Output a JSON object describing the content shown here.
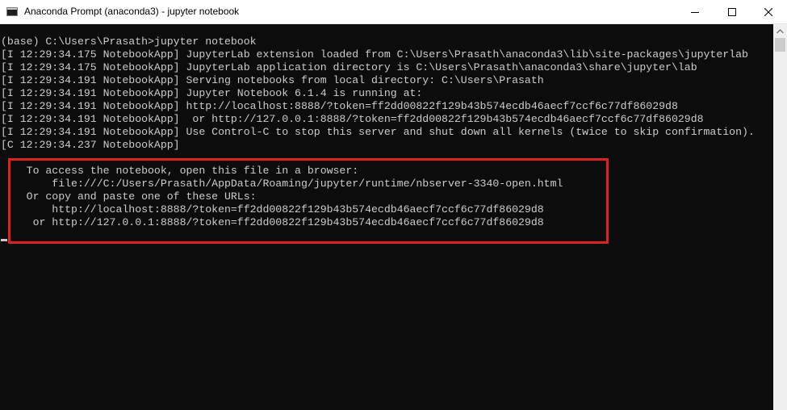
{
  "window": {
    "title": "Anaconda Prompt (anaconda3) - jupyter  notebook",
    "icon": "terminal-icon"
  },
  "controls": {
    "minimize": "minimize-icon",
    "maximize": "maximize-icon",
    "close": "close-icon"
  },
  "console": {
    "lines": [
      "(base) C:\\Users\\Prasath>jupyter notebook",
      "[I 12:29:34.175 NotebookApp] JupyterLab extension loaded from C:\\Users\\Prasath\\anaconda3\\lib\\site-packages\\jupyterlab",
      "[I 12:29:34.175 NotebookApp] JupyterLab application directory is C:\\Users\\Prasath\\anaconda3\\share\\jupyter\\lab",
      "[I 12:29:34.191 NotebookApp] Serving notebooks from local directory: C:\\Users\\Prasath",
      "[I 12:29:34.191 NotebookApp] Jupyter Notebook 6.1.4 is running at:",
      "[I 12:29:34.191 NotebookApp] http://localhost:8888/?token=ff2dd00822f129b43b574ecdb46aecf7ccf6c77df86029d8",
      "[I 12:29:34.191 NotebookApp]  or http://127.0.0.1:8888/?token=ff2dd00822f129b43b574ecdb46aecf7ccf6c77df86029d8",
      "[I 12:29:34.191 NotebookApp] Use Control-C to stop this server and shut down all kernels (twice to skip confirmation).",
      "[C 12:29:34.237 NotebookApp]",
      "",
      "    To access the notebook, open this file in a browser:",
      "        file:///C:/Users/Prasath/AppData/Roaming/jupyter/runtime/nbserver-3340-open.html",
      "    Or copy and paste one of these URLs:",
      "        http://localhost:8888/?token=ff2dd00822f129b43b574ecdb46aecf7ccf6c77df86029d8",
      "     or http://127.0.0.1:8888/?token=ff2dd00822f129b43b574ecdb46aecf7ccf6c77df86029d8"
    ]
  },
  "colors": {
    "console_bg": "#0c0c0c",
    "console_text": "#cccccc",
    "highlight_border": "#e02020"
  }
}
